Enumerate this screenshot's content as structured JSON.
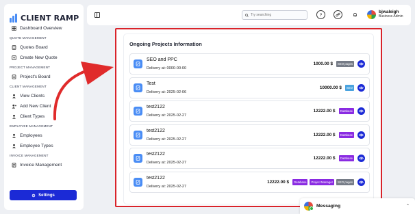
{
  "brand": {
    "name": "CLIENT RAMP"
  },
  "sidebar": {
    "items": [
      {
        "type": "item",
        "label": "Dashboard Overview",
        "icon": "grid-icon"
      },
      {
        "type": "section",
        "label": "QUOTE MANAGEMENT"
      },
      {
        "type": "item",
        "label": "Quotes Board",
        "icon": "board-icon"
      },
      {
        "type": "item",
        "label": "Create New Quote",
        "icon": "plus-square-icon"
      },
      {
        "type": "section",
        "label": "PROJECT MANAGEMENT"
      },
      {
        "type": "item",
        "label": "Project's Board",
        "icon": "board-icon",
        "active": true
      },
      {
        "type": "section",
        "label": "CLIENT MANAGEMENT"
      },
      {
        "type": "item",
        "label": "View Clients",
        "icon": "user-icon"
      },
      {
        "type": "item",
        "label": "Add New Client",
        "icon": "user-plus-icon"
      },
      {
        "type": "item",
        "label": "Client Types",
        "icon": "user-icon"
      },
      {
        "type": "section",
        "label": "EMPLOYEE MANAGEMENT"
      },
      {
        "type": "item",
        "label": "Employees",
        "icon": "user-icon"
      },
      {
        "type": "item",
        "label": "Employee Types",
        "icon": "user-icon"
      },
      {
        "type": "section",
        "label": "INVOICE MANAGEMENT"
      },
      {
        "type": "item",
        "label": "Invoice Management",
        "icon": "invoice-icon"
      }
    ],
    "settings_label": "Settings"
  },
  "header": {
    "search_placeholder": "Try searching",
    "user_name": "bjwaleigh",
    "user_role": "Business Admin"
  },
  "main": {
    "title": "Ongoing Projects Information",
    "projects": [
      {
        "name": "SEO and PPC",
        "date": "Delivery at: 0000-00-00",
        "price": "1000.00 $",
        "tags": [
          {
            "label": "SEO pages",
            "color": "seo"
          }
        ]
      },
      {
        "name": "Test",
        "date": "Delivery at: 2025-02-06",
        "price": "10000.00 $",
        "tags": [
          {
            "label": "SEO",
            "color": "blue"
          }
        ]
      },
      {
        "name": "test2122",
        "date": "Delivery at: 2025-02-27",
        "price": "12222.00 $",
        "tags": [
          {
            "label": "Database",
            "color": "purple"
          }
        ]
      },
      {
        "name": "test2122",
        "date": "Delivery at: 2025-02-27",
        "price": "12222.00 $",
        "tags": [
          {
            "label": "Database",
            "color": "purple"
          }
        ]
      },
      {
        "name": "test2122",
        "date": "Delivery at: 2025-02-27",
        "price": "12222.00 $",
        "tags": [
          {
            "label": "Database",
            "color": "purple"
          }
        ]
      },
      {
        "name": "test2122",
        "date": "Delivery at: 2025-02-27",
        "price": "12222.00 $",
        "tags": [
          {
            "label": "Database",
            "color": "purple"
          },
          {
            "label": "Project Manager",
            "color": "purple"
          },
          {
            "label": "SEO pages",
            "color": "seo"
          }
        ]
      }
    ]
  },
  "messaging": {
    "label": "Messaging"
  },
  "colors": {
    "accent": "#1b2ad6",
    "highlight": "#d9232a",
    "project_icon": "#4a8df5"
  }
}
